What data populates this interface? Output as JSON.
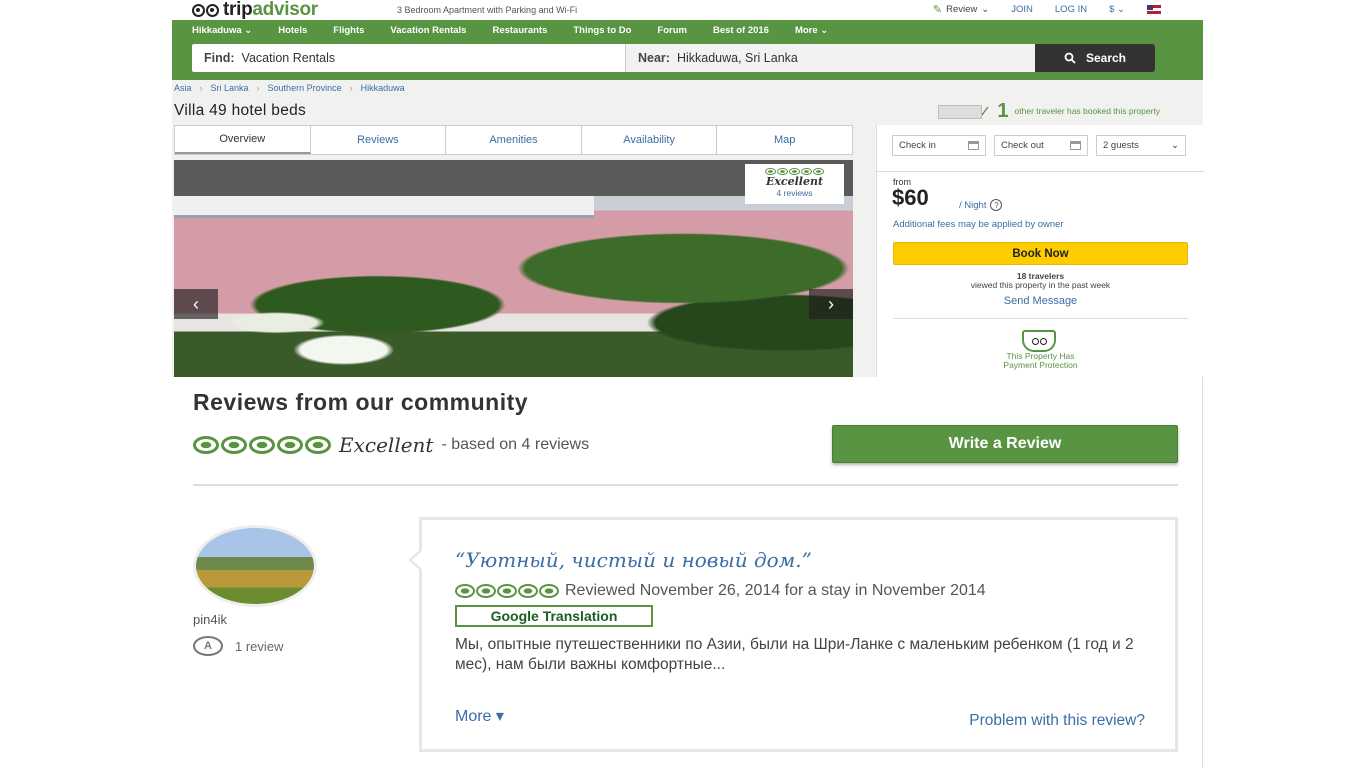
{
  "header": {
    "logo_trip": "trip",
    "logo_advisor": "advisor",
    "tagline": "3 Bedroom Apartment with Parking and Wi-Fi",
    "review_label": "Review",
    "join_label": "JOIN",
    "login_label": "LOG IN",
    "currency_label": "$"
  },
  "nav": {
    "items": [
      "Hikkaduwa ⌄",
      "Hotels",
      "Flights",
      "Vacation Rentals",
      "Restaurants",
      "Things to Do",
      "Forum",
      "Best of 2016",
      "More ⌄"
    ]
  },
  "search": {
    "find_label": "Find:",
    "find_value": "Vacation Rentals",
    "near_label": "Near:",
    "near_value": "Hikkaduwa, Sri Lanka",
    "button_label": "Search"
  },
  "breadcrumb": [
    "Asia",
    "Sri Lanka",
    "Southern Province",
    "Hikkaduwa"
  ],
  "property": {
    "title": "Villa 49 hotel beds",
    "booked_count": "1",
    "booked_text": "other traveler has booked this property"
  },
  "tabs": [
    "Overview",
    "Reviews",
    "Amenities",
    "Availability",
    "Map"
  ],
  "photo": {
    "rating_word": "Excellent",
    "rating_count": "4 reviews"
  },
  "booking": {
    "checkin_label": "Check in",
    "checkout_label": "Check out",
    "guests_label": "2 guests",
    "from_label": "from",
    "price": "$60",
    "per_night": "/ Night",
    "fees_text": "Additional fees may be applied by owner",
    "book_label": "Book Now",
    "viewed_count": "18 travelers",
    "viewed_text": "viewed this property in the past week",
    "send_message": "Send Message",
    "protection_line1": "This Property Has",
    "protection_line2": "Payment Protection"
  },
  "reviews": {
    "heading": "Reviews from our community",
    "overall_word": "Excellent",
    "overall_based": "- based on 4 reviews",
    "write_label": "Write a Review",
    "overall_rating": 5
  },
  "review": {
    "username": "pin4ik",
    "review_count": "1 review",
    "title": "“Уютный, чистый и новый дом.”",
    "rating": 5,
    "reviewed_text": "Reviewed November 26, 2014 for a stay in November 2014",
    "translation_badge": "Google Translation",
    "body": "Мы, опытные путешественники по Азии, были на Шри-Ланке с маленьким ребенком (1 год и 2 мес), нам были важны комфортные...",
    "more_label": "More ▾",
    "problem_label": "Problem with this review?"
  },
  "colors": {
    "brand_green": "#589442",
    "link_blue": "#3a6ea5",
    "book_yellow": "#ffcc00"
  }
}
